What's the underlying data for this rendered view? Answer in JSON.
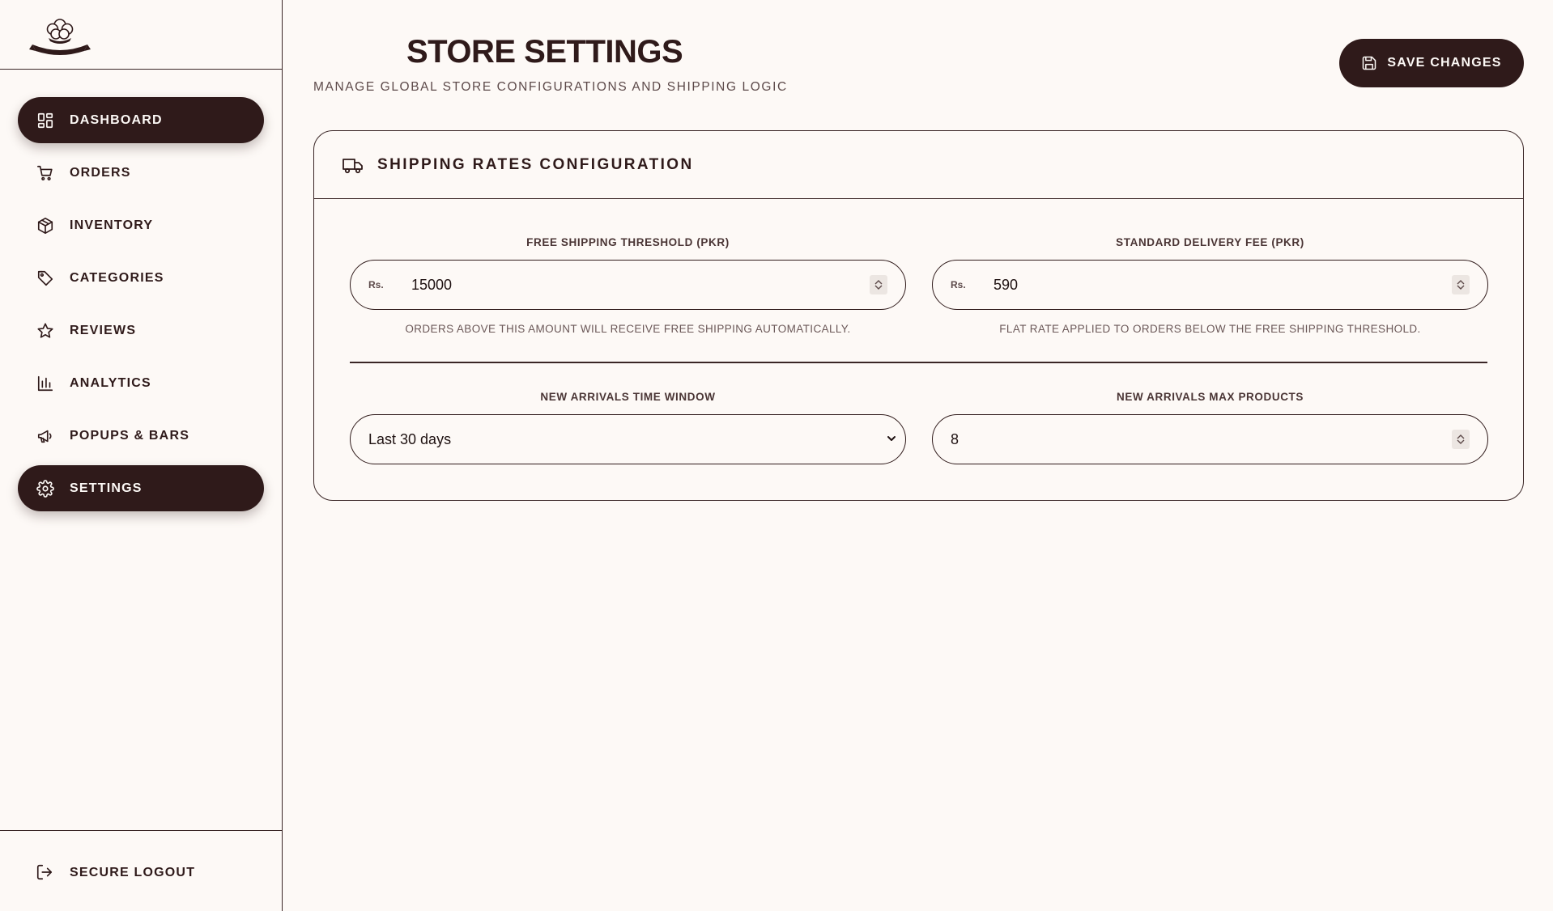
{
  "sidebar": {
    "items": [
      {
        "label": "DASHBOARD",
        "icon": "dashboard-icon",
        "active": true
      },
      {
        "label": "ORDERS",
        "icon": "cart-icon",
        "active": false
      },
      {
        "label": "INVENTORY",
        "icon": "box-icon",
        "active": false
      },
      {
        "label": "CATEGORIES",
        "icon": "tag-icon",
        "active": false
      },
      {
        "label": "REVIEWS",
        "icon": "star-icon",
        "active": false
      },
      {
        "label": "ANALYTICS",
        "icon": "bar-chart-icon",
        "active": false
      },
      {
        "label": "POPUPS & BARS",
        "icon": "megaphone-icon",
        "active": false
      },
      {
        "label": "SETTINGS",
        "icon": "gear-icon",
        "active": true
      }
    ],
    "logout_label": "SECURE LOGOUT"
  },
  "header": {
    "title": "STORE SETTINGS",
    "subtitle": "MANAGE GLOBAL STORE CONFIGURATIONS AND SHIPPING LOGIC",
    "save_label": "SAVE CHANGES"
  },
  "card": {
    "title": "SHIPPING RATES CONFIGURATION",
    "fields": {
      "free_shipping": {
        "label": "FREE SHIPPING THRESHOLD (PKR)",
        "prefix": "Rs.",
        "value": "15000",
        "help": "ORDERS ABOVE THIS AMOUNT WILL RECEIVE FREE SHIPPING AUTOMATICALLY."
      },
      "delivery_fee": {
        "label": "STANDARD DELIVERY FEE (PKR)",
        "prefix": "Rs.",
        "value": "590",
        "help": "FLAT RATE APPLIED TO ORDERS BELOW THE FREE SHIPPING THRESHOLD."
      },
      "time_window": {
        "label": "NEW ARRIVALS TIME WINDOW",
        "value": "Last 30 days"
      },
      "max_products": {
        "label": "NEW ARRIVALS MAX PRODUCTS",
        "value": "8"
      }
    }
  },
  "colors": {
    "brand": "#2f1a1a",
    "background": "#fdf9f6",
    "muted_text": "#6b5858"
  }
}
